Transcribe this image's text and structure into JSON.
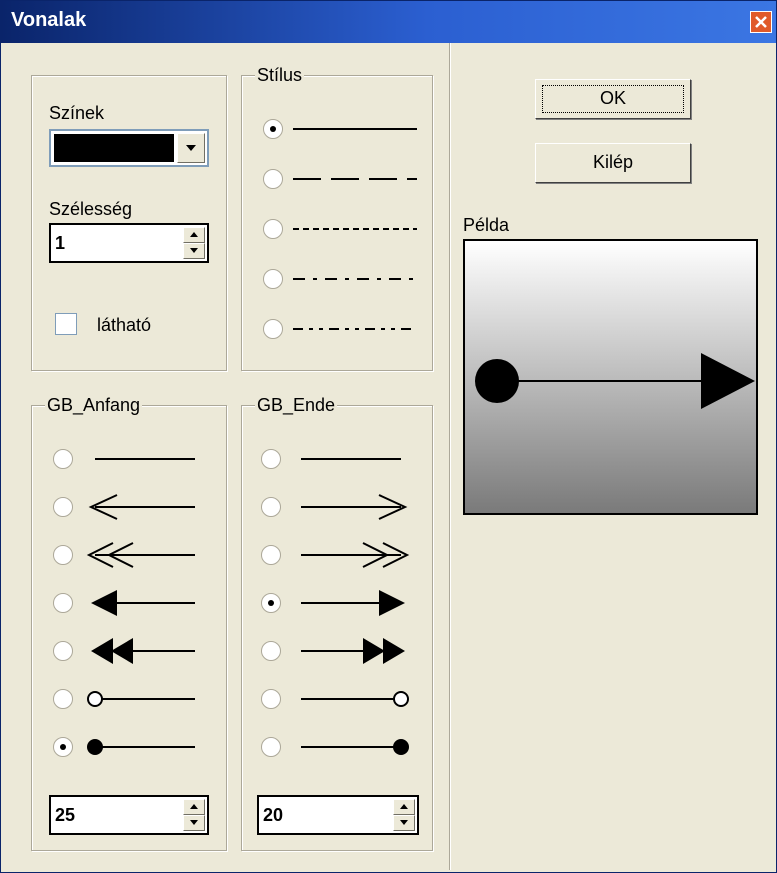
{
  "window": {
    "title": "Vonalak"
  },
  "colors": {
    "label": "Színek",
    "selected_color": "#000000"
  },
  "width": {
    "label": "Szélesség",
    "value": "1"
  },
  "visible": {
    "label": "látható",
    "checked": false
  },
  "style": {
    "label": "Stílus",
    "options": [
      "solid",
      "dashed",
      "dotted",
      "dash-dot",
      "dash-dot-dot"
    ],
    "selected": "solid"
  },
  "start": {
    "label": "GB_Anfang",
    "options": [
      "none",
      "open-arrow",
      "double-open-arrow",
      "filled-arrow",
      "double-filled-arrow",
      "open-circle",
      "filled-circle"
    ],
    "selected": "filled-circle",
    "size": "25"
  },
  "end": {
    "label": "GB_Ende",
    "options": [
      "none",
      "open-arrow",
      "double-open-arrow",
      "filled-arrow",
      "double-filled-arrow",
      "open-circle",
      "filled-circle"
    ],
    "selected": "filled-arrow",
    "size": "20"
  },
  "buttons": {
    "ok": "OK",
    "exit": "Kilép"
  },
  "preview": {
    "label": "Példa"
  }
}
